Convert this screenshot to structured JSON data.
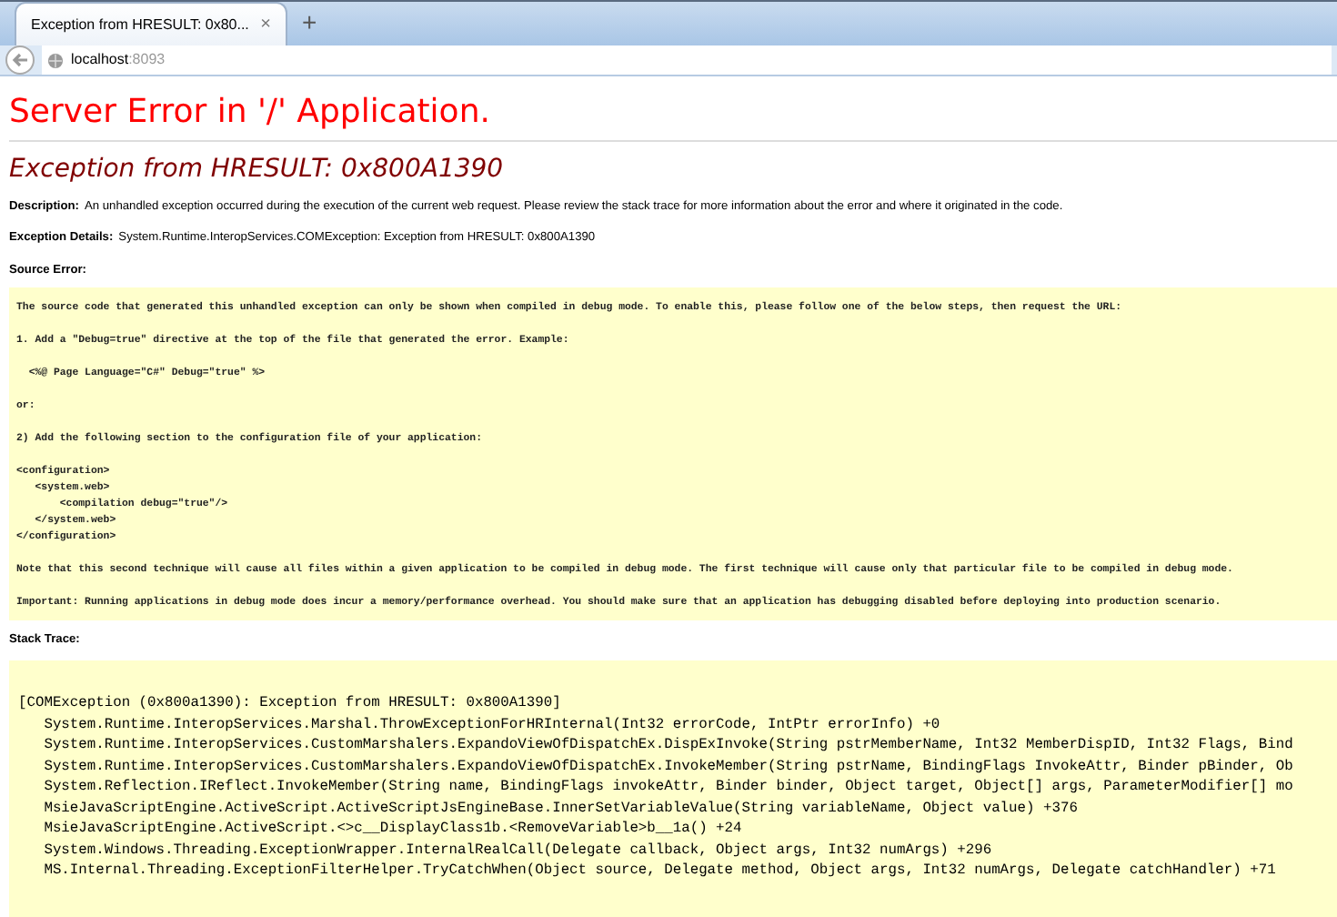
{
  "browser": {
    "tab": {
      "title": "Exception from HRESULT: 0x80...",
      "close": "×"
    },
    "new_tab": "+",
    "address": {
      "host": "localhost",
      "port": ":8093"
    }
  },
  "page": {
    "title": "Server Error in '/' Application.",
    "exception_heading": "Exception from HRESULT: 0x800A1390",
    "fields": [
      {
        "label": "Description:",
        "value": "An unhandled exception occurred during the execution of the current web request. Please review the stack trace for more information about the error and where it originated in the code."
      },
      {
        "label": "Exception Details:",
        "value": "System.Runtime.InteropServices.COMException: Exception from HRESULT: 0x800A1390"
      }
    ],
    "source_error": {
      "label": "Source Error:",
      "blocks": [
        {
          "lines": [
            "The source code that generated this unhandled exception can only be shown when compiled in debug mode. To enable this, please follow one of the below steps, then request the URL:"
          ]
        },
        {
          "lines": [
            "1. Add a \"Debug=true\" directive at the top of the file that generated the error. Example:"
          ]
        },
        {
          "lines": [
            "  <%@ Page Language=\"C#\" Debug=\"true\" %>"
          ]
        },
        {
          "lines": [
            "or:"
          ]
        },
        {
          "lines": [
            "2) Add the following section to the configuration file of your application:"
          ]
        },
        {
          "lines": [
            "<configuration>",
            "   <system.web>",
            "       <compilation debug=\"true\"/>",
            "   </system.web>",
            "</configuration>"
          ]
        },
        {
          "lines": [
            "Note that this second technique will cause all files within a given application to be compiled in debug mode. The first technique will cause only that particular file to be compiled in debug mode."
          ]
        },
        {
          "lines": [
            "Important: Running applications in debug mode does incur a memory/performance overhead. You should make sure that an application has debugging disabled before deploying into production scenario."
          ]
        }
      ]
    },
    "stack_trace": {
      "label": "Stack Trace:",
      "lines": [
        "[COMException (0x800a1390): Exception from HRESULT: 0x800A1390]",
        "   System.Runtime.InteropServices.Marshal.ThrowExceptionForHRInternal(Int32 errorCode, IntPtr errorInfo) +0",
        "   System.Runtime.InteropServices.CustomMarshalers.ExpandoViewOfDispatchEx.DispExInvoke(String pstrMemberName, Int32 MemberDispID, Int32 Flags, Bind",
        "   System.Runtime.InteropServices.CustomMarshalers.ExpandoViewOfDispatchEx.InvokeMember(String pstrName, BindingFlags InvokeAttr, Binder pBinder, Ob",
        "   System.Reflection.IReflect.InvokeMember(String name, BindingFlags invokeAttr, Binder binder, Object target, Object[] args, ParameterModifier[] mo",
        "   MsieJavaScriptEngine.ActiveScript.ActiveScriptJsEngineBase.InnerSetVariableValue(String variableName, Object value) +376",
        "   MsieJavaScriptEngine.ActiveScript.<>c__DisplayClass1b.<RemoveVariable>b__1a() +24",
        "   System.Windows.Threading.ExceptionWrapper.InternalRealCall(Delegate callback, Object args, Int32 numArgs) +296",
        "   MS.Internal.Threading.ExceptionFilterHelper.TryCatchWhen(Object source, Delegate method, Object args, Int32 numArgs, Delegate catchHandler) +71"
      ]
    }
  }
}
